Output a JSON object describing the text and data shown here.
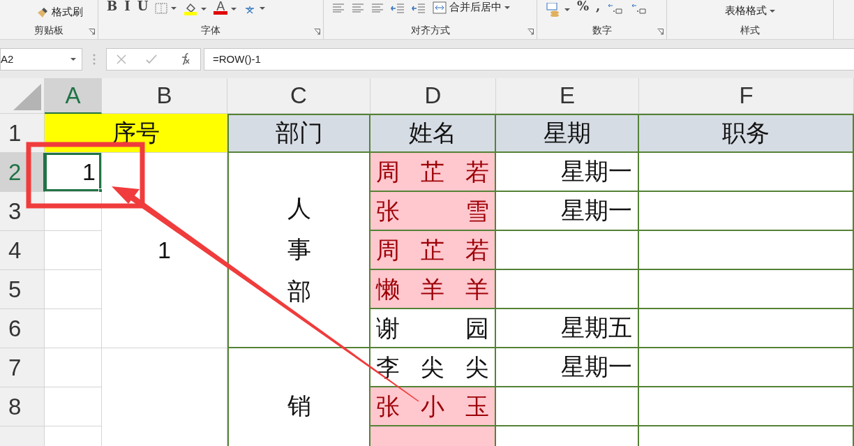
{
  "ribbon": {
    "groups": [
      {
        "label": "剪贴板",
        "buttons": [
          {
            "kind": "brush",
            "label": "格式刷"
          }
        ]
      },
      {
        "label": "字体",
        "buttons": [
          {
            "kind": "glyph",
            "label": "B"
          },
          {
            "kind": "glyph",
            "label": "I"
          },
          {
            "kind": "glyph",
            "label": "U"
          },
          {
            "kind": "border"
          },
          {
            "kind": "fill"
          },
          {
            "kind": "fontcolor",
            "label": "A"
          },
          {
            "kind": "phonetic"
          }
        ]
      },
      {
        "label": "对齐方式",
        "buttons": [
          {
            "kind": "align"
          },
          {
            "kind": "align"
          },
          {
            "kind": "align"
          },
          {
            "kind": "indent"
          },
          {
            "kind": "indent"
          },
          {
            "kind": "merge",
            "label": "合并后居中"
          }
        ]
      },
      {
        "label": "数字",
        "buttons": [
          {
            "kind": "currency"
          },
          {
            "kind": "glyph",
            "label": "%"
          },
          {
            "kind": "glyph",
            "label": ","
          },
          {
            "kind": "decimal"
          },
          {
            "kind": "decimal"
          }
        ]
      },
      {
        "label": "样式",
        "buttons": [
          {
            "kind": "dropdown",
            "label": "表格格式"
          }
        ]
      }
    ]
  },
  "formula_bar": {
    "name_box": "A2",
    "formula": "=ROW()-1"
  },
  "sheet": {
    "columns": [
      {
        "label": "A",
        "selected": true
      },
      {
        "label": "B",
        "selected": false
      },
      {
        "label": "C",
        "selected": false
      },
      {
        "label": "D",
        "selected": false
      },
      {
        "label": "E",
        "selected": false
      },
      {
        "label": "F",
        "selected": false
      }
    ],
    "rows": [
      {
        "label": "1",
        "selected": false,
        "cells": [
          {
            "kind": "title",
            "text": "序号",
            "selected": false
          },
          {
            "kind": "continued_left"
          },
          {
            "kind": "header",
            "text": "部门",
            "selected": false
          },
          {
            "kind": "header",
            "text": "姓名",
            "selected": false
          },
          {
            "kind": "header",
            "text": "星期",
            "selected": false
          },
          {
            "kind": "header",
            "text": "职务",
            "selected": false
          }
        ]
      },
      {
        "label": "2",
        "selected": true,
        "cells": [
          {
            "kind": "number",
            "text": "1",
            "selected": true
          },
          {
            "kind": "merged",
            "selected": false
          },
          {
            "kind": "vertical",
            "selected": false
          },
          {
            "kind": "highlight",
            "text": "周芷若",
            "selected": false
          },
          {
            "kind": "weekday",
            "text": "星期一",
            "selected": false
          },
          {
            "kind": "blank",
            "selected": false
          }
        ]
      },
      {
        "label": "3",
        "selected": false,
        "cells": [
          {
            "kind": "blank",
            "selected": false
          },
          {
            "kind": "continued_up"
          },
          {
            "kind": "continued_up"
          },
          {
            "kind": "highlight",
            "text": "张雪",
            "selected": false
          },
          {
            "kind": "weekday",
            "text": "星期一",
            "selected": false
          },
          {
            "kind": "blank",
            "selected": false
          }
        ]
      },
      {
        "label": "4",
        "selected": false,
        "cells": [
          {
            "kind": "blank",
            "selected": false
          },
          {
            "kind": "continued_up",
            "text": "1"
          },
          {
            "kind": "continued_up",
            "text": "人事部"
          },
          {
            "kind": "highlight",
            "text": "周芷若",
            "selected": false
          },
          {
            "kind": "blank",
            "selected": false
          },
          {
            "kind": "blank",
            "selected": false
          }
        ]
      },
      {
        "label": "5",
        "selected": false,
        "cells": [
          {
            "kind": "blank",
            "selected": false
          },
          {
            "kind": "continued_up"
          },
          {
            "kind": "continued_up"
          },
          {
            "kind": "highlight",
            "text": "懒羊羊",
            "selected": false
          },
          {
            "kind": "blank",
            "selected": false
          },
          {
            "kind": "blank",
            "selected": false
          }
        ]
      },
      {
        "label": "6",
        "selected": false,
        "cells": [
          {
            "kind": "blank",
            "selected": false
          },
          {
            "kind": "continued_up"
          },
          {
            "kind": "continued_up"
          },
          {
            "kind": "name",
            "text": "谢园",
            "selected": false
          },
          {
            "kind": "weekday",
            "text": "星期五",
            "selected": false
          },
          {
            "kind": "blank",
            "selected": false
          }
        ]
      },
      {
        "label": "7",
        "selected": false,
        "cells": [
          {
            "kind": "blank",
            "selected": false
          },
          {
            "kind": "merged",
            "selected": false
          },
          {
            "kind": "vertical",
            "selected": false
          },
          {
            "kind": "name",
            "text": "李尖尖",
            "selected": false
          },
          {
            "kind": "weekday",
            "text": "星期一",
            "selected": false
          },
          {
            "kind": "blank",
            "selected": false
          }
        ]
      },
      {
        "label": "8",
        "selected": false,
        "cells": [
          {
            "kind": "blank",
            "selected": false
          },
          {
            "kind": "continued_up"
          },
          {
            "kind": "continued_up",
            "text": "销"
          },
          {
            "kind": "highlight",
            "text": "张小玉",
            "selected": false
          },
          {
            "kind": "blank",
            "selected": false
          },
          {
            "kind": "blank",
            "selected": false
          }
        ]
      },
      {
        "selected": false,
        "cells": [
          {
            "kind": "blank",
            "selected": false
          },
          {
            "kind": "continued_up"
          },
          {
            "kind": "continued_up"
          },
          {
            "kind": "highlight",
            "selected": false
          },
          {
            "kind": "blank",
            "selected": false
          },
          {
            "kind": "blank",
            "selected": false
          }
        ]
      }
    ]
  }
}
